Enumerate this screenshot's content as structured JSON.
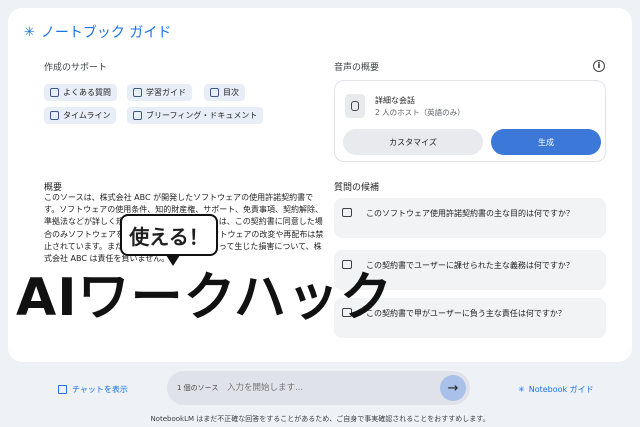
{
  "header": {
    "title": "ノートブック ガイド",
    "spark_glyph": "✳"
  },
  "creation_support": {
    "label": "作成のサポート",
    "chips": [
      {
        "label": "よくある質問",
        "icon": "faq-icon"
      },
      {
        "label": "学習ガイド",
        "icon": "study-guide-icon"
      },
      {
        "label": "目次",
        "icon": "toc-icon"
      },
      {
        "label": "タイムライン",
        "icon": "timeline-icon"
      },
      {
        "label": "ブリーフィング・ドキュメント",
        "icon": "briefing-icon"
      }
    ]
  },
  "audio_overview": {
    "label": "音声の概要",
    "info_glyph": "i",
    "title": "詳細な会話",
    "subtitle": "2 人のホスト（英語のみ）",
    "customize_label": "カスタマイズ",
    "generate_label": "生成"
  },
  "summary": {
    "heading": "概要",
    "body": "このソースは、株式会社 ABC が開発したソフトウェアの使用許諾契約書です。ソフトウェアの使用条件、知的財産権、サポート、免責事項、契約解除、準拠法などが詳しく規定されています。ユーザーは、この契約書に同意した場合のみソフトウェアを使用することができ、ソフトウェアの改変や再配布は禁止されています。また、ソフトウェアの使用によって生じた損害について、株式会社 ABC は責任を負いません。"
  },
  "questions": {
    "heading": "質問の候補",
    "items": [
      "このソフトウェア使用許諾契約書の主な目的は何ですか？",
      "この契約書でユーザーに課せられた主な義務は何ですか？",
      "この契約書で甲がユーザーに負う主な責任は何ですか？"
    ]
  },
  "overlay": {
    "speech_bubble": "使える！",
    "logo_text": "AIワークハック"
  },
  "bottom": {
    "chat_label": "チャットを表示",
    "source_count": "1 個のソース",
    "input_placeholder": "入力を開始します...",
    "send_glyph": "→",
    "guide_label": "Notebook ガイド",
    "disclaimer": "NotebookLM はまだ不正確な回答をすることがあるため、ご自身で事実確認されることをおすすめします。"
  },
  "colors": {
    "accent": "#1a73e8",
    "generate_button": "#3c78d8",
    "background": "#eef1f6"
  }
}
